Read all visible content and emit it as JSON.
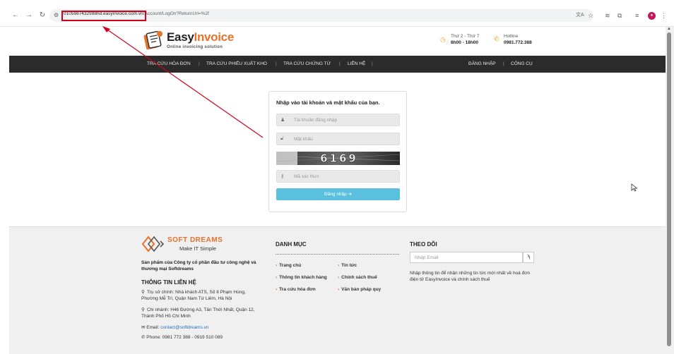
{
  "browser": {
    "url_host": "0105987432998hd.easyinvoice.com.vn",
    "url_path": "/Account/LogOn?ReturnUrl=%2f"
  },
  "header": {
    "logo_prefix": "Easy",
    "logo_suffix": "Invoice",
    "tagline": "Online invoicing solution",
    "hours_label": "Thứ 2 - Thứ 7",
    "hours_value": "8h00 - 18h00",
    "hotline_label": "Hotline",
    "hotline_value": "0981.772.388"
  },
  "nav": {
    "items": [
      "TRA CỨU HÓA ĐƠN",
      "TRA CỨU PHIẾU XUẤT KHO",
      "TRA CỨU CHỨNG TỪ",
      "LIÊN HỆ"
    ],
    "right_items": [
      "ĐĂNG NHẬP",
      "CÔNG CỤ"
    ]
  },
  "login": {
    "title": "Nhập vào tài khoản và mật khẩu của bạn.",
    "username_placeholder": "Tài khoản đăng nhập",
    "password_placeholder": "Mật khẩu",
    "captcha_text": "6169",
    "captcha_placeholder": "Mã xác thực",
    "submit_label": "Đăng nhập ➜"
  },
  "footer": {
    "brand_name": "SOFT DREAMS",
    "brand_tag": "Make IT Simple",
    "company_desc": "Sản phẩm của Công ty cổ phần đầu tư công nghệ và thương mại Softdreams",
    "contact_heading": "THÔNG TIN LIÊN HỆ",
    "hq_address": "Trụ sở chính: Nhà khách ATS, Số 8 Phạm Hùng, Phường Mễ Trì, Quận Nam Từ Liêm, Hà Nội",
    "branch_address": "Chi nhánh: H46 Đường A3, Tân Thới Nhất, Quận 12, Thành Phố Hồ Chí Minh",
    "email_label": "Email:",
    "email_value": "contact@softdreams.vn",
    "phone": "Phone: 0981 772 388 - 0919 510 089",
    "category_heading": "DANH MỤC",
    "category_links": [
      "Trang chủ",
      "Tin tức",
      "Thông tin khách hàng",
      "Chính sách thuế",
      "Tra cứu hóa đơn",
      "Văn bản pháp quy"
    ],
    "follow_heading": "THEO DÕI",
    "email_placeholder": "Nhập Email",
    "follow_desc": "Nhập thông tin để nhận những tin tức mới nhất về hoá đơn điện tử EasyInvoice và chính sách thuế"
  },
  "colors": {
    "accent": "#e8722a",
    "nav_bg": "#2b2b2b",
    "button": "#5bc0de",
    "annotation": "#d0021b"
  }
}
